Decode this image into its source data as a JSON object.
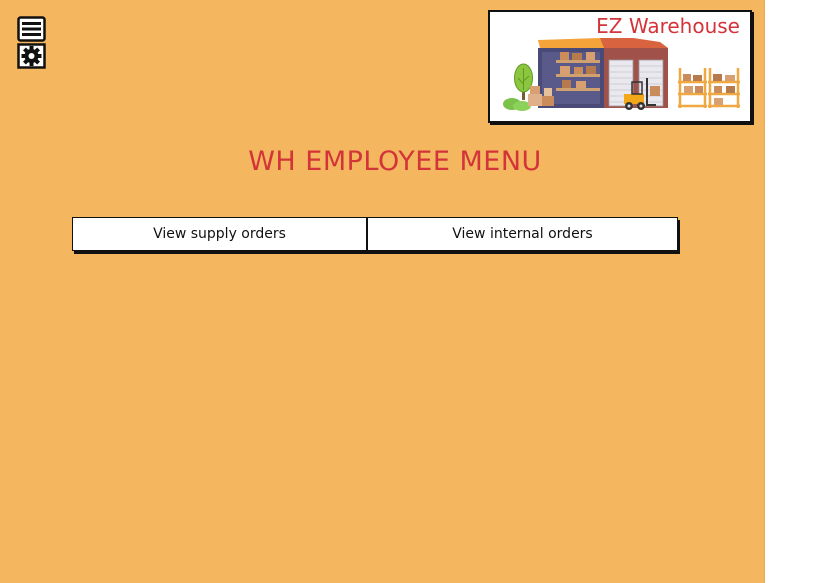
{
  "app": {
    "brand": "EZ Warehouse",
    "page_title": "WH EMPLOYEE MENU"
  },
  "toolbar": {
    "menu_icon": "menu-icon",
    "settings_icon": "gear-icon"
  },
  "menu": {
    "buttons": [
      {
        "label": "View supply orders"
      },
      {
        "label": "View internal orders"
      }
    ]
  },
  "colors": {
    "background": "#f4b75f",
    "accent_text": "#d3343a",
    "button_bg": "#ffffff",
    "outline": "#111111"
  }
}
